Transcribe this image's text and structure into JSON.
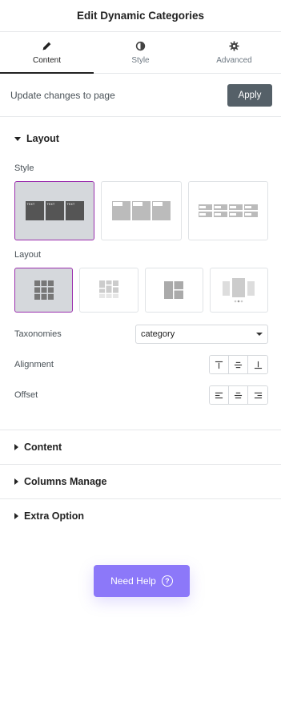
{
  "header": {
    "title": "Edit Dynamic Categories"
  },
  "tabs": [
    {
      "label": "Content",
      "icon": "pencil-icon",
      "active": true
    },
    {
      "label": "Style",
      "icon": "contrast-icon",
      "active": false
    },
    {
      "label": "Advanced",
      "icon": "gear-icon",
      "active": false
    }
  ],
  "update": {
    "text": "Update changes to page",
    "apply_label": "Apply"
  },
  "layout_section": {
    "title": "Layout",
    "style_label": "Style",
    "layout_label": "Layout",
    "mini_text": "TEXT",
    "taxonomies": {
      "label": "Taxonomies",
      "value": "category"
    },
    "alignment": {
      "label": "Alignment",
      "options": [
        "top",
        "middle",
        "bottom"
      ]
    },
    "offset": {
      "label": "Offset",
      "options": [
        "left",
        "center",
        "right"
      ]
    }
  },
  "sections": [
    {
      "title": "Content"
    },
    {
      "title": "Columns Manage"
    },
    {
      "title": "Extra Option"
    }
  ],
  "help": {
    "label": "Need Help",
    "accent": "#8c78f9"
  },
  "colors": {
    "selected_border": "#9b2fae",
    "apply_bg": "#556068"
  }
}
